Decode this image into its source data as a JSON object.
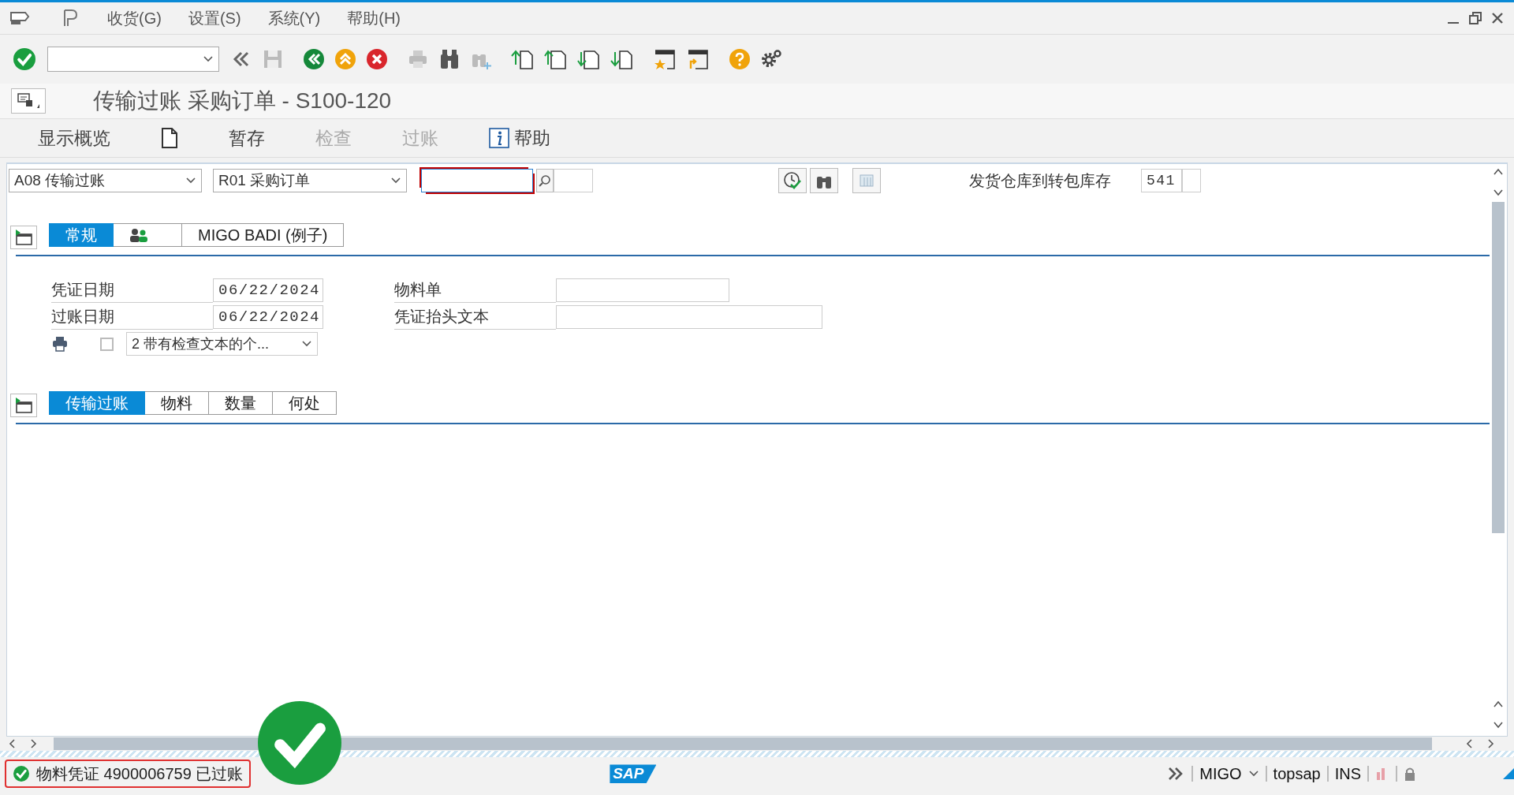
{
  "menu_bar": {
    "items": [
      "收货(G)",
      "设置(S)",
      "系统(Y)",
      "帮助(H)"
    ]
  },
  "title": "传输过账 采购订单 - S100-120",
  "app_toolbar": {
    "items": [
      {
        "kind": "text",
        "label": "显示概览",
        "disabled": false
      },
      {
        "kind": "new-document",
        "disabled": false
      },
      {
        "kind": "text",
        "label": "暂存",
        "disabled": false
      },
      {
        "kind": "text",
        "label": "检查",
        "disabled": true
      },
      {
        "kind": "text",
        "label": "过账",
        "disabled": true
      },
      {
        "kind": "help",
        "label": "帮助",
        "disabled": false
      }
    ]
  },
  "header": {
    "action": "A08 传输过账",
    "reference": "R01 采购订单",
    "movement_label": "发货仓库到转包库存",
    "movement_type": "541"
  },
  "header_tabs": [
    {
      "kind": "text",
      "label": "常规",
      "selected": true
    },
    {
      "kind": "people",
      "selected": false
    },
    {
      "kind": "text",
      "label": "MIGO BADI (例子)",
      "selected": false
    }
  ],
  "general": {
    "document_date": {
      "label": "凭证日期",
      "value": "06/22/2024"
    },
    "posting_date": {
      "label": "过账日期",
      "value": "06/22/2024"
    },
    "print": {
      "checked": false,
      "option": "2 带有检查文本的个..."
    },
    "material_slip": {
      "label": "物料单"
    },
    "header_text": {
      "label": "凭证抬头文本"
    }
  },
  "item_tabs": [
    {
      "label": "传输过账",
      "selected": true
    },
    {
      "label": "物料",
      "selected": false
    },
    {
      "label": "数量",
      "selected": false
    },
    {
      "label": "何处",
      "selected": false
    }
  ],
  "status": {
    "message": "物料凭证 4900006759 已过账"
  },
  "status_bar": {
    "logo": "SAP",
    "transaction": "MIGO",
    "system": "topsap",
    "mode": "INS"
  }
}
